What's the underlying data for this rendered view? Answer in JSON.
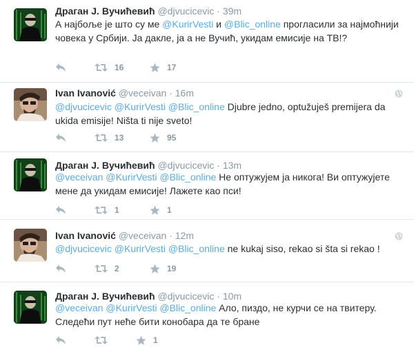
{
  "colors": {
    "link": "#55acee",
    "meta": "#8899a6",
    "icon": "#aab8c2",
    "divider": "#e1e8ed"
  },
  "icons": [
    "reply-icon",
    "retweet-icon",
    "favorite-icon",
    "globe-icon"
  ],
  "tweets": [
    {
      "fullname": "Драган Ј. Вучићевић",
      "username": "@djvucicevic",
      "sep": "·",
      "time": "39m",
      "parts": [
        "А најбоље је што су ме ",
        "@KurirVesti",
        " и ",
        "@Blic_online",
        " прогласили за најмоћнији човека у Србији. Ја дакле, ја а не Вучић, укидам емисије на ТВ!?"
      ],
      "retweets": "16",
      "favorites": "17"
    },
    {
      "fullname": "Ivan Ivanović",
      "username": "@veceivan",
      "sep": "·",
      "time": "16m",
      "parts": [
        "@djvucicevic",
        " ",
        "@KurirVesti",
        " ",
        "@Blic_online",
        " Djubre jedno, optužuješ premijera da ukida emisije! Ništa ti nije sveto!"
      ],
      "retweets": "13",
      "favorites": "95"
    },
    {
      "fullname": "Драган Ј. Вучићевић",
      "username": "@djvucicevic",
      "sep": "·",
      "time": "13m",
      "parts": [
        "@veceivan",
        " ",
        "@KurirVesti",
        " ",
        "@Blic_online",
        " Не оптужујем ја никога! Ви оптужујете мене да укидам емисије! Лажете као пси!"
      ],
      "retweets": "1",
      "favorites": "1"
    },
    {
      "fullname": "Ivan Ivanović",
      "username": "@veceivan",
      "sep": "·",
      "time": "12m",
      "parts": [
        "@djvucicevic",
        " ",
        "@KurirVesti",
        " ",
        "@Blic_online",
        " ne kukaj siso, rekao si šta si rekao !"
      ],
      "retweets": "2",
      "favorites": "19"
    },
    {
      "fullname": "Драган Ј. Вучићевић",
      "username": "@djvucicevic",
      "sep": "·",
      "time": "10m",
      "parts": [
        "@veceivan",
        " ",
        "@KurirVesti",
        " ",
        "@Blic_online",
        " Ало, пиздо, не курчи се на твитеру. Следећи пут неће бити конобара да те бране"
      ],
      "retweets": "",
      "favorites": "1"
    }
  ]
}
